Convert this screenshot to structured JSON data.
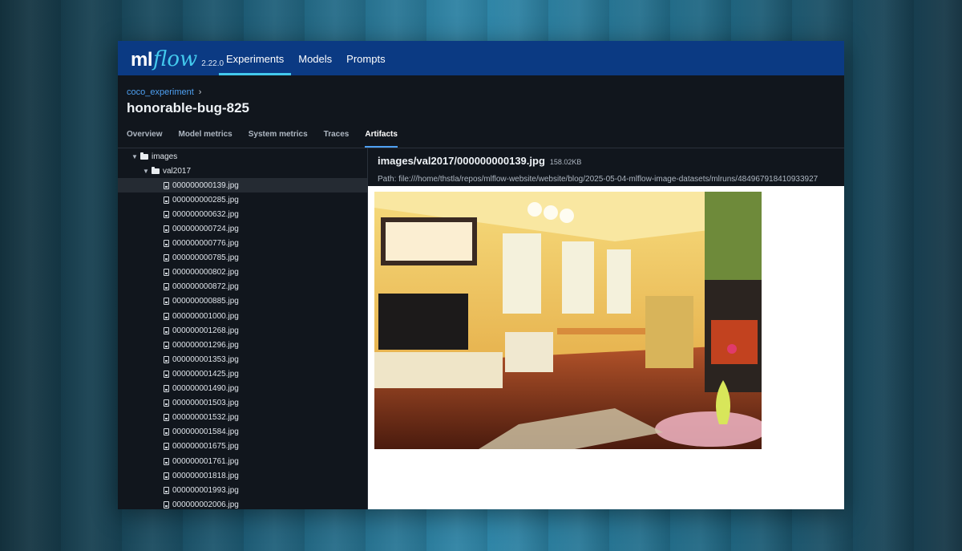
{
  "app": {
    "logo_ml": "ml",
    "logo_flow": "flow",
    "version": "2.22.0"
  },
  "nav": {
    "items": [
      {
        "label": "Experiments",
        "active": true
      },
      {
        "label": "Models",
        "active": false
      },
      {
        "label": "Prompts",
        "active": false
      }
    ]
  },
  "breadcrumb": {
    "experiment": "coco_experiment",
    "separator": "›"
  },
  "run": {
    "title": "honorable-bug-825"
  },
  "tabs": [
    {
      "label": "Overview",
      "active": false
    },
    {
      "label": "Model metrics",
      "active": false
    },
    {
      "label": "System metrics",
      "active": false
    },
    {
      "label": "Traces",
      "active": false
    },
    {
      "label": "Artifacts",
      "active": true
    }
  ],
  "tree": {
    "root_folder": "images",
    "sub_folder": "val2017",
    "files": [
      "000000000139.jpg",
      "000000000285.jpg",
      "000000000632.jpg",
      "000000000724.jpg",
      "000000000776.jpg",
      "000000000785.jpg",
      "000000000802.jpg",
      "000000000872.jpg",
      "000000000885.jpg",
      "000000001000.jpg",
      "000000001268.jpg",
      "000000001296.jpg",
      "000000001353.jpg",
      "000000001425.jpg",
      "000000001490.jpg",
      "000000001503.jpg",
      "000000001532.jpg",
      "000000001584.jpg",
      "000000001675.jpg",
      "000000001761.jpg",
      "000000001818.jpg",
      "000000001993.jpg",
      "000000002006.jpg"
    ],
    "selected_index": 0
  },
  "preview": {
    "file_path": "images/val2017/000000000139.jpg",
    "file_size": "158.02KB",
    "full_path": "Path: file:///home/thstla/repos/mlflow-website/website/blog/2025-05-04-mlflow-image-datasets/mlruns/484967918410933927"
  },
  "colors": {
    "header_bg": "#0b3a83",
    "accent": "#43c9ed",
    "link": "#4ea0f2",
    "panel_bg": "#11161d"
  }
}
